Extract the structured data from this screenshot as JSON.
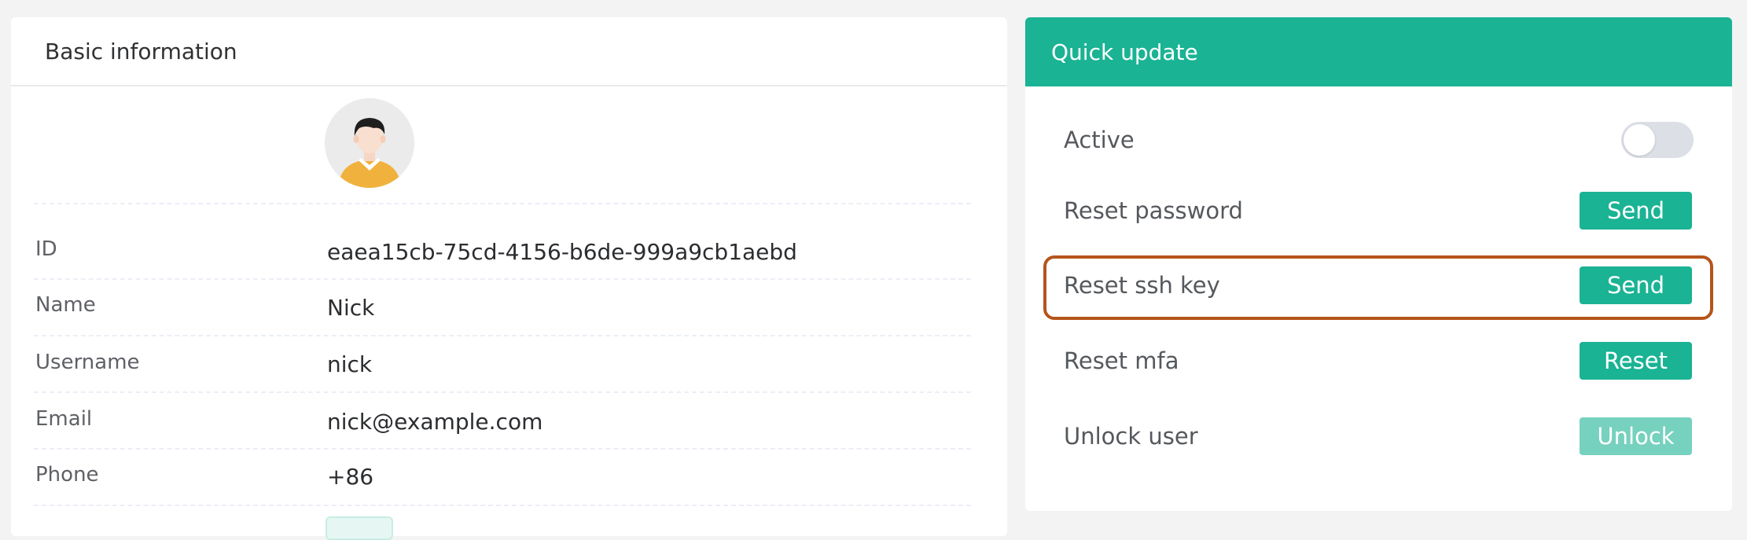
{
  "basic_info": {
    "title": "Basic information",
    "avatar_icon": "user-avatar",
    "rows": [
      {
        "label": "ID",
        "value": "eaea15cb-75cd-4156-b6de-999a9cb1aebd"
      },
      {
        "label": "Name",
        "value": "Nick"
      },
      {
        "label": "Username",
        "value": "nick"
      },
      {
        "label": "Email",
        "value": "nick@example.com"
      },
      {
        "label": "Phone",
        "value": "+86"
      }
    ]
  },
  "quick_update": {
    "title": "Quick update",
    "header_color": "#1ab394",
    "items": [
      {
        "label": "Active",
        "control": "toggle",
        "state": "off"
      },
      {
        "label": "Reset password",
        "button": "Send"
      },
      {
        "label": "Reset ssh key",
        "button": "Send",
        "highlighted": true
      },
      {
        "label": "Reset mfa",
        "button": "Reset"
      },
      {
        "label": "Unlock user",
        "button": "Unlock",
        "disabled": true
      }
    ]
  },
  "colors": {
    "accent": "#1ab394",
    "highlight": "#b5541b"
  }
}
